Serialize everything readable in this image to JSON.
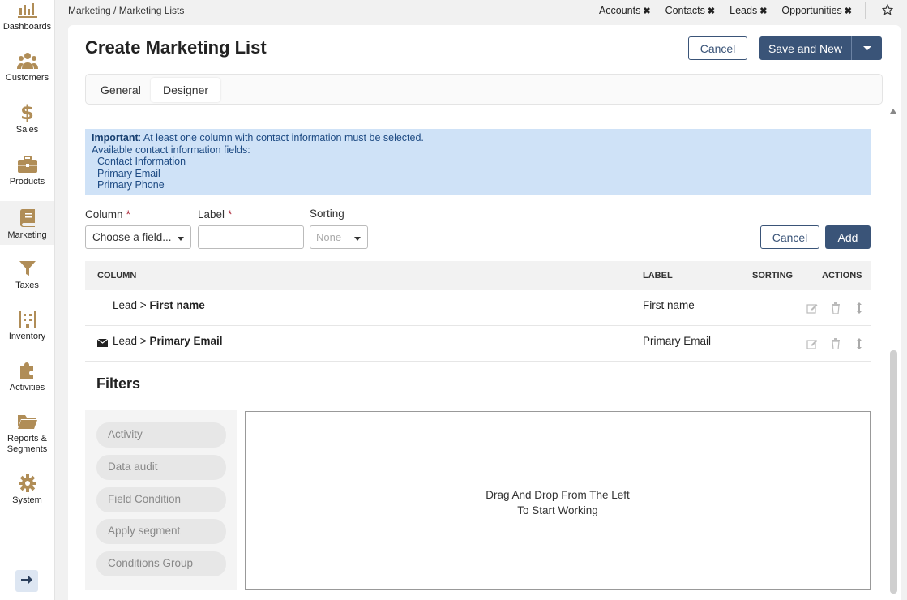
{
  "sidebar": {
    "items": [
      {
        "label": "Dashboards",
        "icon": "bar-chart-icon"
      },
      {
        "label": "Customers",
        "icon": "users-icon"
      },
      {
        "label": "Sales",
        "icon": "dollar-icon"
      },
      {
        "label": "Products",
        "icon": "briefcase-icon"
      },
      {
        "label": "Marketing",
        "icon": "book-icon"
      },
      {
        "label": "Taxes",
        "icon": "funnel-icon"
      },
      {
        "label": "Inventory",
        "icon": "building-icon"
      },
      {
        "label": "Activities",
        "icon": "puzzle-icon"
      },
      {
        "label": "Reports &",
        "label2": "Segments",
        "icon": "folder-icon"
      },
      {
        "label": "System",
        "icon": "gear-icon"
      }
    ],
    "active": "Marketing",
    "accent_color": "#b08d57"
  },
  "topbar": {
    "breadcrumb": "Marketing / Marketing Lists",
    "pins": [
      "Accounts",
      "Contacts",
      "Leads",
      "Opportunities"
    ]
  },
  "page": {
    "title": "Create Marketing List",
    "cancel_label": "Cancel",
    "save_label": "Save and New"
  },
  "tabs": [
    "General",
    "Designer"
  ],
  "notice": {
    "important": "Important",
    "message": ": At least one column with contact information must be selected.",
    "available": "Available contact information fields:",
    "fields": [
      "Contact Information",
      "Primary Email",
      "Primary Phone"
    ]
  },
  "form": {
    "column_label": "Column",
    "label_label": "Label",
    "sorting_label": "Sorting",
    "column_value": "Choose a field...",
    "sorting_value": "None",
    "cancel_label": "Cancel",
    "add_label": "Add",
    "required_mark": "*"
  },
  "table": {
    "headers": [
      "COLUMN",
      "LABEL",
      "SORTING",
      "ACTIONS"
    ],
    "rows": [
      {
        "prefix": "Lead >",
        "field": "First name",
        "label": "First name",
        "has_email_icon": false
      },
      {
        "prefix": "Lead >",
        "field": "Primary Email",
        "label": "Primary Email",
        "has_email_icon": true
      }
    ]
  },
  "filters": {
    "title": "Filters",
    "criteria": [
      "Activity",
      "Data audit",
      "Field Condition",
      "Apply segment",
      "Conditions Group"
    ],
    "dropzone_line1": "Drag And Drop From The Left",
    "dropzone_line2": "To Start Working"
  },
  "colors": {
    "primary": "#3a5478",
    "notice_bg": "#cfe2f7",
    "notice_text": "#1d4a83"
  }
}
